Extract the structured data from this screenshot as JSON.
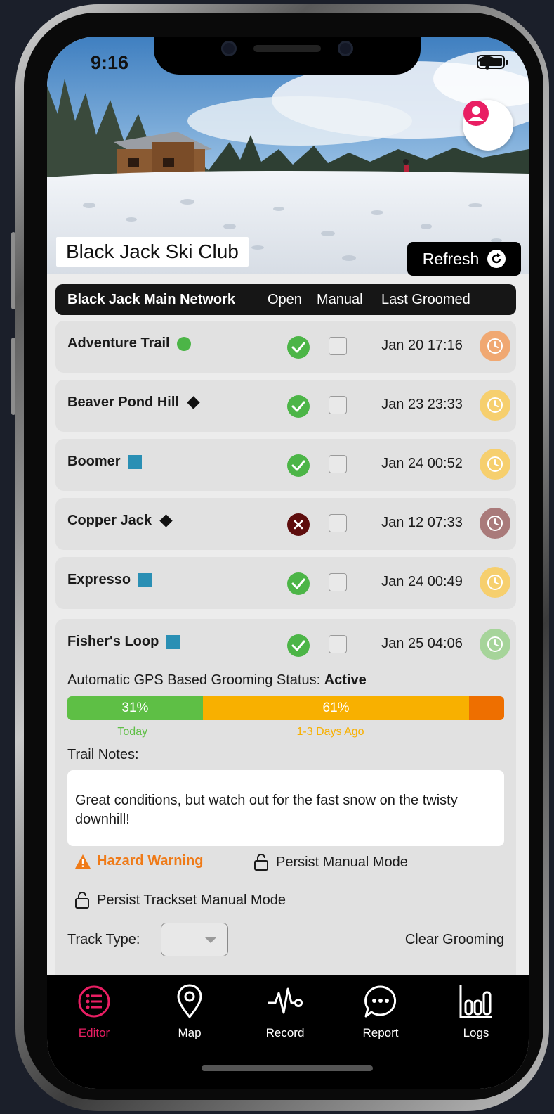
{
  "status_bar": {
    "time": "9:16"
  },
  "header": {
    "club_name": "Black Jack Ski Club",
    "refresh_label": "Refresh"
  },
  "network": {
    "name": "Black Jack Main Network",
    "col_open": "Open",
    "col_manual": "Manual",
    "col_last_groomed": "Last Groomed"
  },
  "trails": [
    {
      "name": "Adventure Trail",
      "difficulty": "green-circle",
      "open": true,
      "manual": false,
      "last_groomed": "Jan 20 17:16",
      "clock_color": "#f0a872"
    },
    {
      "name": "Beaver Pond Hill",
      "difficulty": "black-diamond",
      "open": true,
      "manual": false,
      "last_groomed": "Jan 23 23:33",
      "clock_color": "#f6cf6e"
    },
    {
      "name": "Boomer",
      "difficulty": "blue-square",
      "open": true,
      "manual": false,
      "last_groomed": "Jan 24 00:52",
      "clock_color": "#f6cf6e"
    },
    {
      "name": "Copper Jack",
      "difficulty": "black-diamond",
      "open": false,
      "manual": false,
      "last_groomed": "Jan 12 07:33",
      "clock_color": "#a97a7a"
    },
    {
      "name": "Expresso",
      "difficulty": "blue-square",
      "open": true,
      "manual": false,
      "last_groomed": "Jan 24 00:49",
      "clock_color": "#f6cf6e"
    },
    {
      "name": "Fisher's Loop",
      "difficulty": "blue-square",
      "open": true,
      "manual": false,
      "last_groomed": "Jan 25 04:06",
      "clock_color": "#a6d49a"
    }
  ],
  "detail": {
    "gps_label": "Automatic GPS Based Grooming Status:",
    "gps_status": "Active",
    "bar": {
      "today_pct": 31,
      "recent_pct": 61,
      "old_pct": 8,
      "today_text": "31%",
      "recent_text": "61%",
      "today_label": "Today",
      "recent_label": "1-3 Days Ago",
      "today_color": "#5ebf45",
      "recent_color": "#f8b000",
      "old_color": "#ee6f00"
    },
    "notes_label": "Trail Notes:",
    "notes_text": "Great conditions, but watch out for the fast snow on the twisty downhill!",
    "hazard_label": "Hazard Warning",
    "persist_manual_label": "Persist Manual Mode",
    "persist_trackset_label": "Persist Trackset Manual Mode",
    "track_type_label": "Track Type:",
    "clear_grooming_label": "Clear Grooming"
  },
  "tabs": [
    {
      "label": "Editor",
      "icon": "list-icon",
      "active": true
    },
    {
      "label": "Map",
      "icon": "map-pin-icon",
      "active": false
    },
    {
      "label": "Record",
      "icon": "activity-icon",
      "active": false
    },
    {
      "label": "Report",
      "icon": "chat-bubble-icon",
      "active": false
    },
    {
      "label": "Logs",
      "icon": "bar-chart-icon",
      "active": false
    }
  ],
  "colors": {
    "accent": "#e91e63",
    "open_green": "#4cb547",
    "closed_red": "#5e0d0d",
    "hazard_orange": "#ef7a17"
  }
}
